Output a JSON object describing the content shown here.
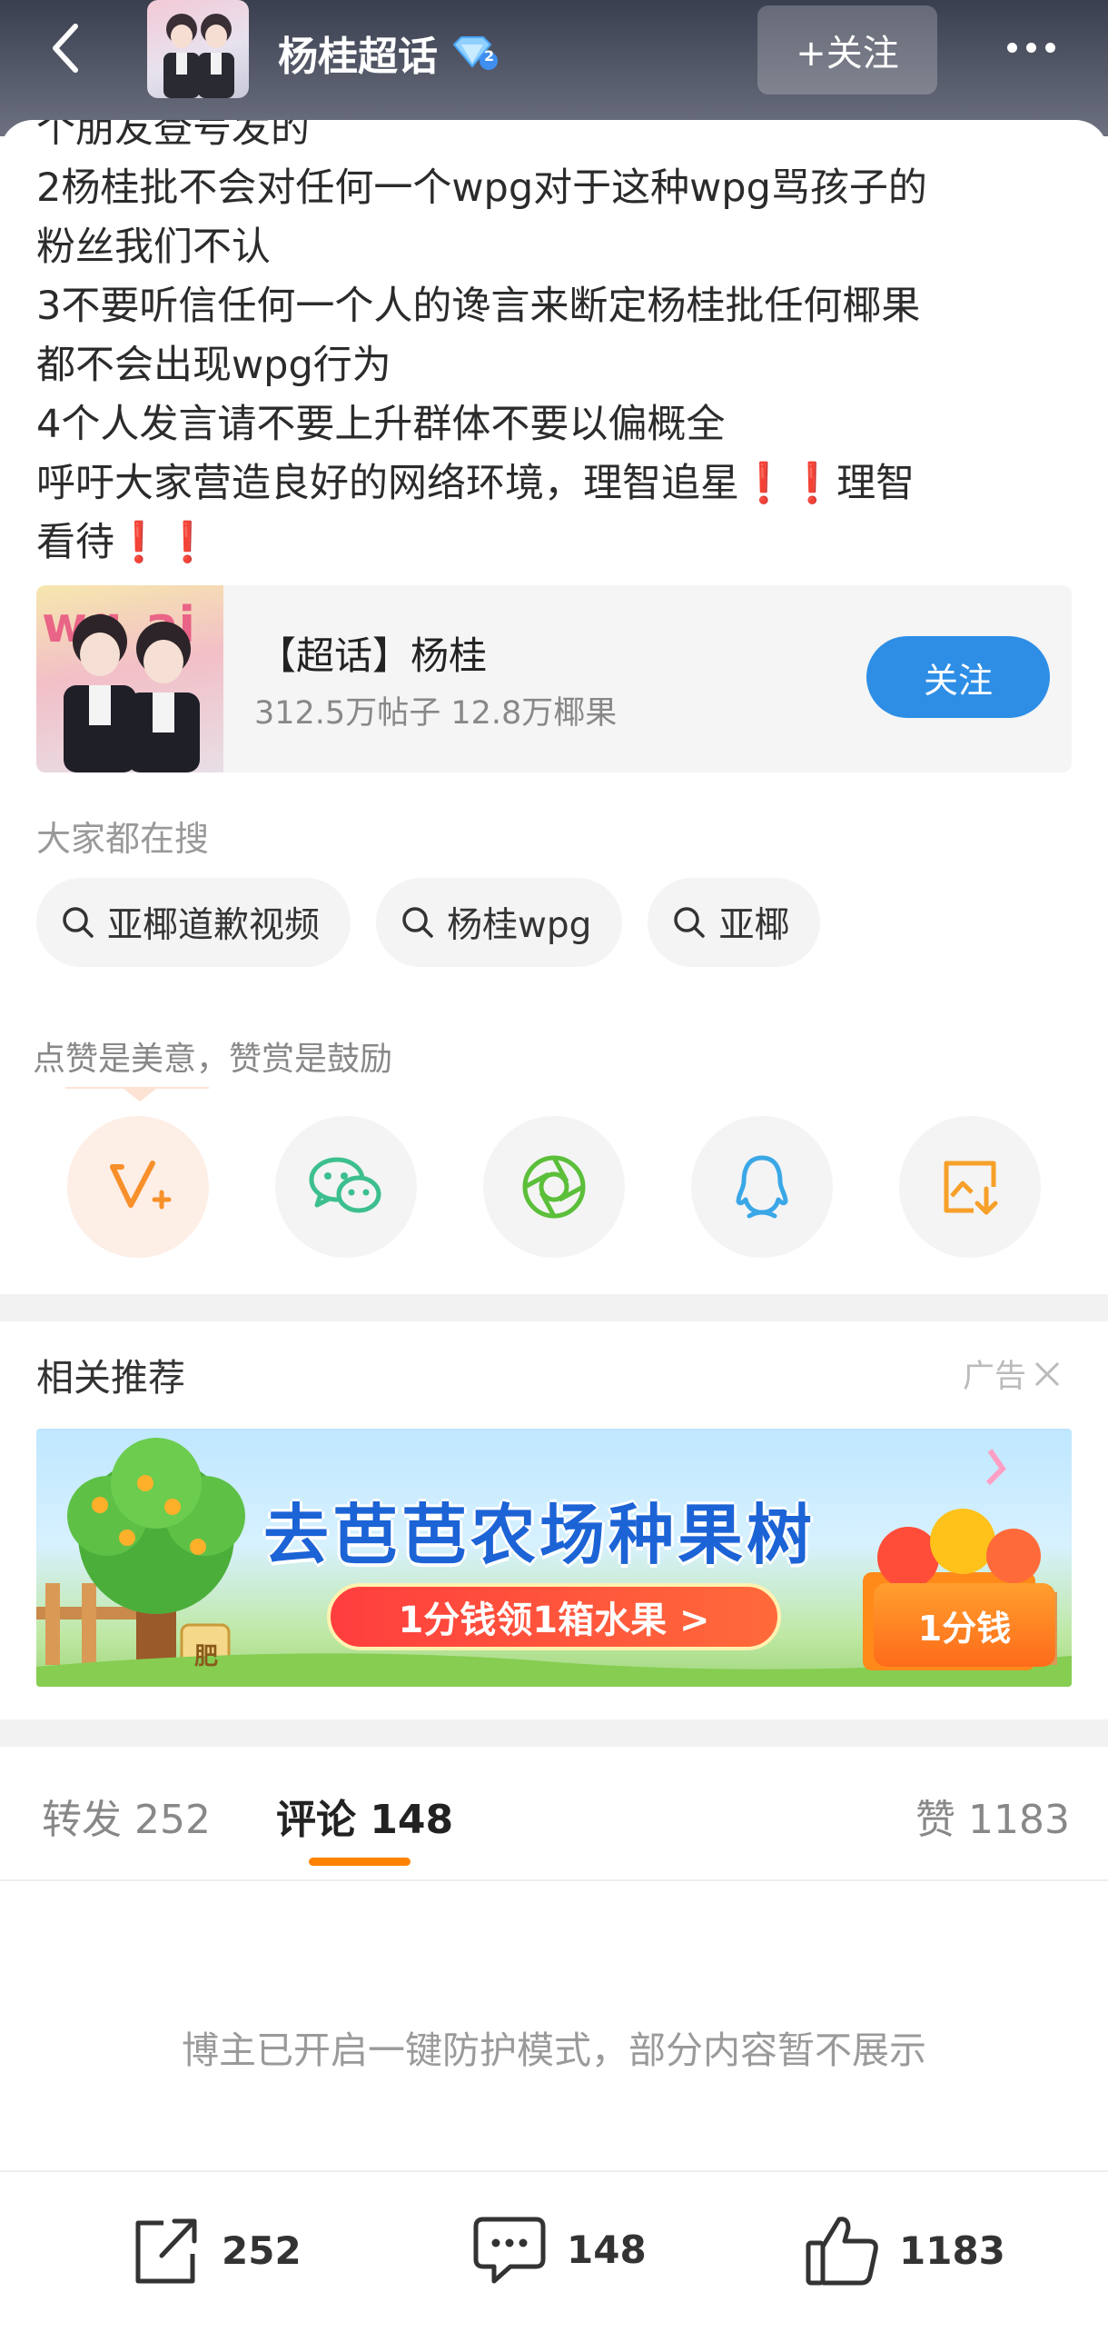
{
  "header": {
    "title": "杨桂超话",
    "follow_label": "+关注",
    "level_badge": "2"
  },
  "post": {
    "lines": [
      "个朋友登号发的",
      "2杨桂批不会对任何一个wpg对于这种wpg骂孩子的",
      "粉丝我们不认",
      "3不要听信任何一个人的谗言来断定杨桂批任何椰果",
      "都不会出现wpg行为",
      "4个人发言请不要上升群体不要以偏概全",
      "呼吁大家营造良好的网络环境，理智追星❗❗理智",
      "看待❗❗"
    ]
  },
  "topic_card": {
    "title": "【超话】杨桂",
    "stats": "312.5万帖子 12.8万椰果",
    "follow_label": "关注"
  },
  "search": {
    "label": "大家都在搜",
    "chips": [
      "亚椰道歉视频",
      "杨桂wpg",
      "亚椰"
    ]
  },
  "reward": {
    "label": "点赞是美意，赞赏是鼓励"
  },
  "share_icons": [
    "reward-v-icon",
    "wechat-icon",
    "moments-icon",
    "qq-icon",
    "save-image-icon"
  ],
  "recommend": {
    "title": "相关推荐",
    "ad_label": "广告"
  },
  "ad": {
    "headline": "去芭芭农场种果树",
    "cta": "1分钱领1箱水果 >",
    "price": "1分钱",
    "fertilizer": "肥"
  },
  "tabs": {
    "repost": "转发 252",
    "comment": "评论 148",
    "like": "赞 1183"
  },
  "protect_message": "博主已开启一键防护模式，部分内容暂不展示",
  "bottom_bar": {
    "repost_count": "252",
    "comment_count": "148",
    "like_count": "1183"
  },
  "colors": {
    "accent_orange": "#ff8200",
    "follow_blue": "#2e8ee6",
    "wechat_green": "#3cbf8e",
    "qq_blue": "#3aa7e6",
    "save_orange": "#f7a02a"
  }
}
